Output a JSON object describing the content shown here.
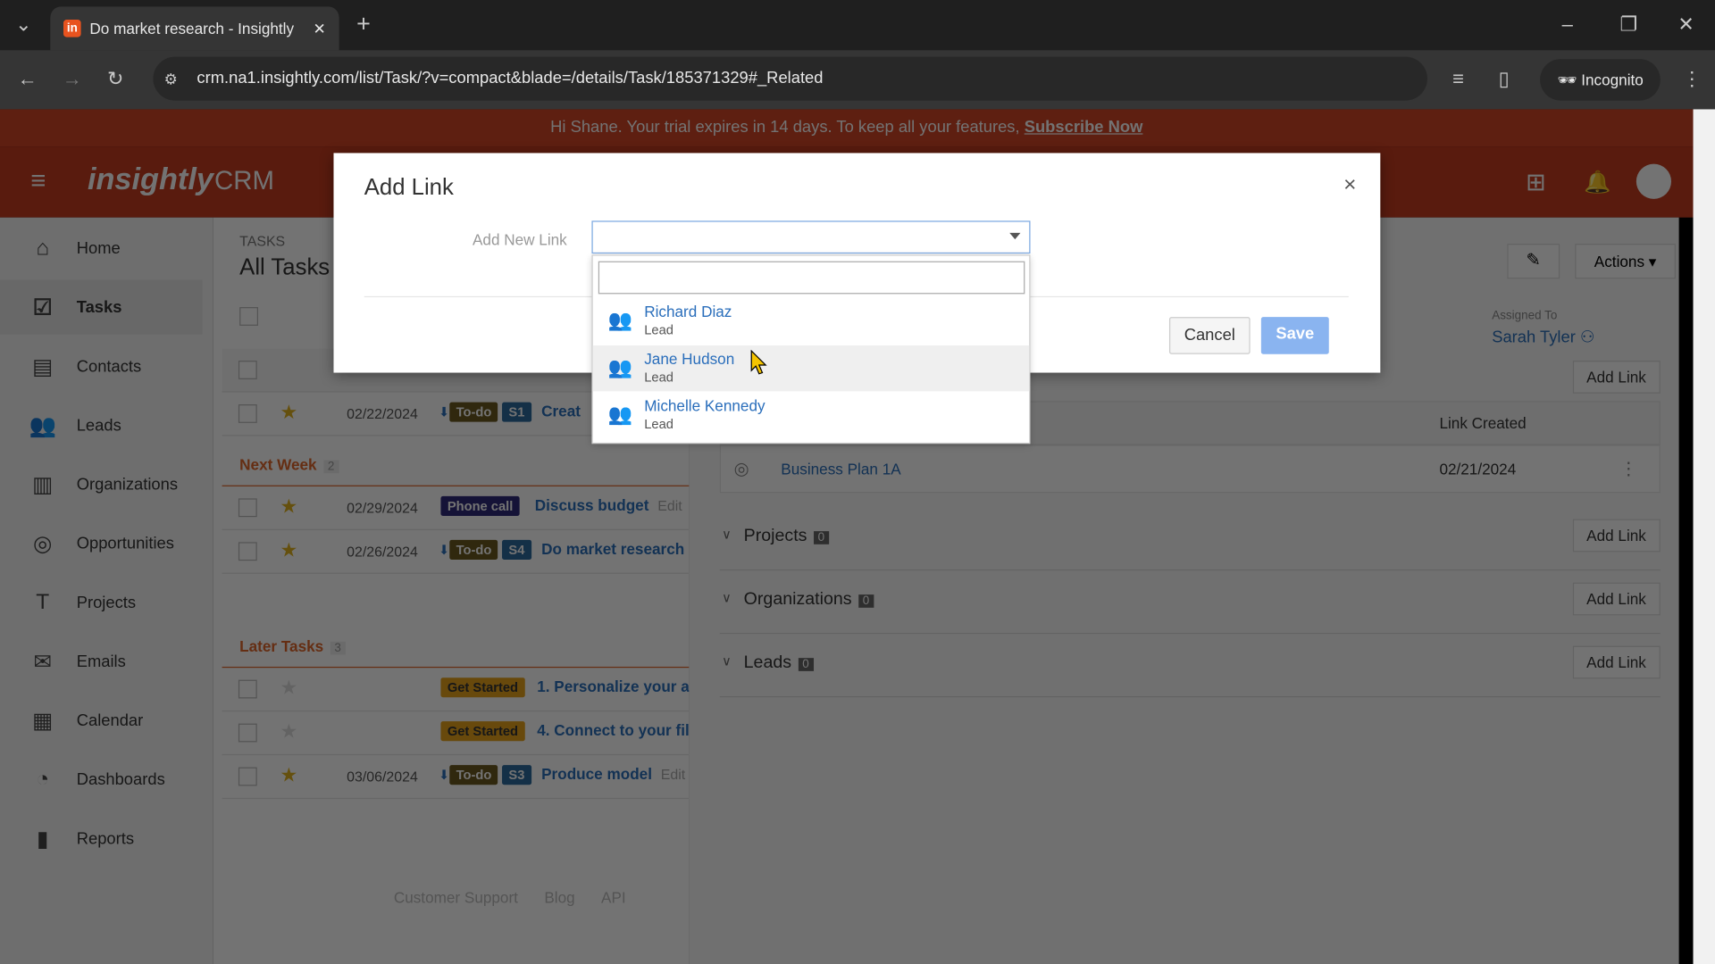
{
  "browser": {
    "tab_title": "Do market research - Insightly",
    "url": "crm.na1.insightly.com/list/Task/?v=compact&blade=/details/Task/185371329#_Related",
    "incognito": "Incognito"
  },
  "banner": {
    "text": "Hi Shane. Your trial expires in 14 days. To keep all your features,",
    "link": "Subscribe Now"
  },
  "header": {
    "logo": "insightly",
    "product": "CRM"
  },
  "sidebar": {
    "items": [
      {
        "label": "Home",
        "icon": "home-icon"
      },
      {
        "label": "Tasks",
        "icon": "check-icon"
      },
      {
        "label": "Contacts",
        "icon": "contact-card-icon"
      },
      {
        "label": "Leads",
        "icon": "people-icon"
      },
      {
        "label": "Organizations",
        "icon": "building-icon"
      },
      {
        "label": "Opportunities",
        "icon": "target-icon"
      },
      {
        "label": "Projects",
        "icon": "pin-icon"
      },
      {
        "label": "Emails",
        "icon": "mail-icon"
      },
      {
        "label": "Calendar",
        "icon": "calendar-icon"
      },
      {
        "label": "Dashboards",
        "icon": "gauge-icon"
      },
      {
        "label": "Reports",
        "icon": "bar-chart-icon"
      }
    ]
  },
  "tasks": {
    "breadcrumb": "TASKS",
    "title": "All Tasks",
    "rows_top": [
      {
        "date": "02/22/2024",
        "status": "To-do",
        "prio": "S1",
        "title": "Creat"
      }
    ],
    "groups": [
      {
        "name": "Next Week",
        "count": "2",
        "rows": [
          {
            "date": "02/29/2024",
            "status": "Phone call",
            "title": "Discuss budget",
            "edit": "Edit"
          },
          {
            "date": "02/26/2024",
            "status": "To-do",
            "prio": "S4",
            "title": "Do market research"
          }
        ]
      },
      {
        "name": "Later Tasks",
        "count": "3",
        "rows": [
          {
            "date": "",
            "status": "Get Started",
            "title": "1. Personalize your a"
          },
          {
            "date": "",
            "status": "Get Started",
            "title": "4. Connect to your fil"
          },
          {
            "date": "03/06/2024",
            "status": "To-do",
            "prio": "S3",
            "title": "Produce model",
            "edit": "Edit"
          }
        ]
      }
    ],
    "footer": [
      "Customer Support",
      "Blog",
      "API"
    ]
  },
  "detail": {
    "actions": "Actions",
    "assigned_label": "Assigned To",
    "assigned_value": "Sarah Tyler",
    "link_created": "Link Created",
    "opportunity": "Business Plan 1A",
    "opportunity_date": "02/21/2024",
    "add_link": "Add Link",
    "sections": [
      {
        "name": "Projects",
        "count": "0"
      },
      {
        "name": "Organizations",
        "count": "0"
      },
      {
        "name": "Leads",
        "count": "0"
      }
    ]
  },
  "modal": {
    "title": "Add Link",
    "field_label": "Add New Link",
    "cancel": "Cancel",
    "save": "Save",
    "options": [
      {
        "name": "Richard Diaz",
        "type": "Lead"
      },
      {
        "name": "Jane Hudson",
        "type": "Lead"
      },
      {
        "name": "Michelle Kennedy",
        "type": "Lead"
      }
    ]
  }
}
